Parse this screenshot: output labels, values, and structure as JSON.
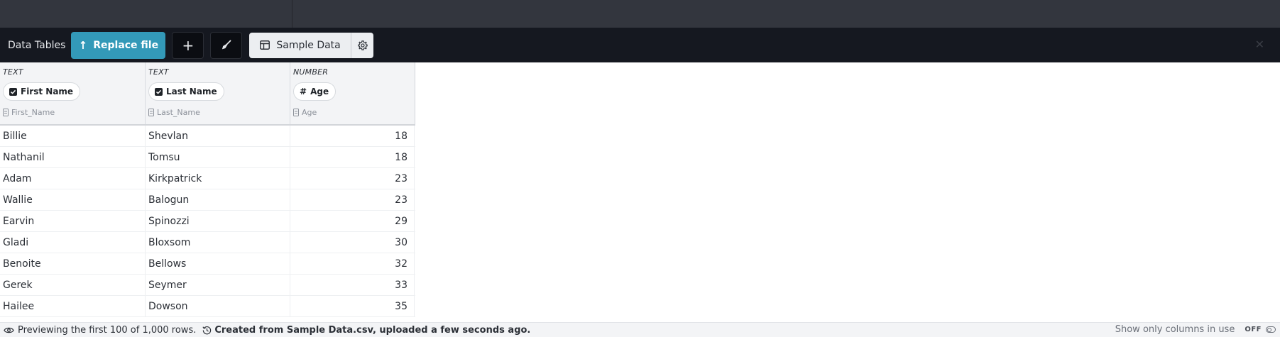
{
  "toolbar": {
    "app_title": "Data Tables",
    "replace_label": "Replace file",
    "add_symbol": "+",
    "dataset_name": "Sample Data"
  },
  "columns": [
    {
      "type": "TEXT",
      "label": "First Name",
      "source": "First_Name",
      "icon": "checkbox-icon"
    },
    {
      "type": "TEXT",
      "label": "Last Name",
      "source": "Last_Name",
      "icon": "checkbox-icon"
    },
    {
      "type": "NUMBER",
      "label": "Age",
      "source": "Age",
      "icon": "hash-icon"
    }
  ],
  "rows": [
    [
      "Billie",
      "Shevlan",
      "18"
    ],
    [
      "Nathanil",
      "Tomsu",
      "18"
    ],
    [
      "Adam",
      "Kirkpatrick",
      "23"
    ],
    [
      "Wallie",
      "Balogun",
      "23"
    ],
    [
      "Earvin",
      "Spinozzi",
      "29"
    ],
    [
      "Gladi",
      "Bloxsom",
      "30"
    ],
    [
      "Benoite",
      "Bellows",
      "32"
    ],
    [
      "Gerek",
      "Seymer",
      "33"
    ],
    [
      "Hailee",
      "Dowson",
      "35"
    ]
  ],
  "footer": {
    "preview_text": "Previewing the first 100 of 1,000 rows.",
    "created_text": "Created from Sample Data.csv, uploaded a few seconds ago.",
    "show_only_label": "Show only columns in use",
    "toggle_state": "OFF"
  },
  "colors": {
    "accent": "#3399b8",
    "toolbar_bg": "#151820",
    "topbar_bg": "#33363e"
  }
}
